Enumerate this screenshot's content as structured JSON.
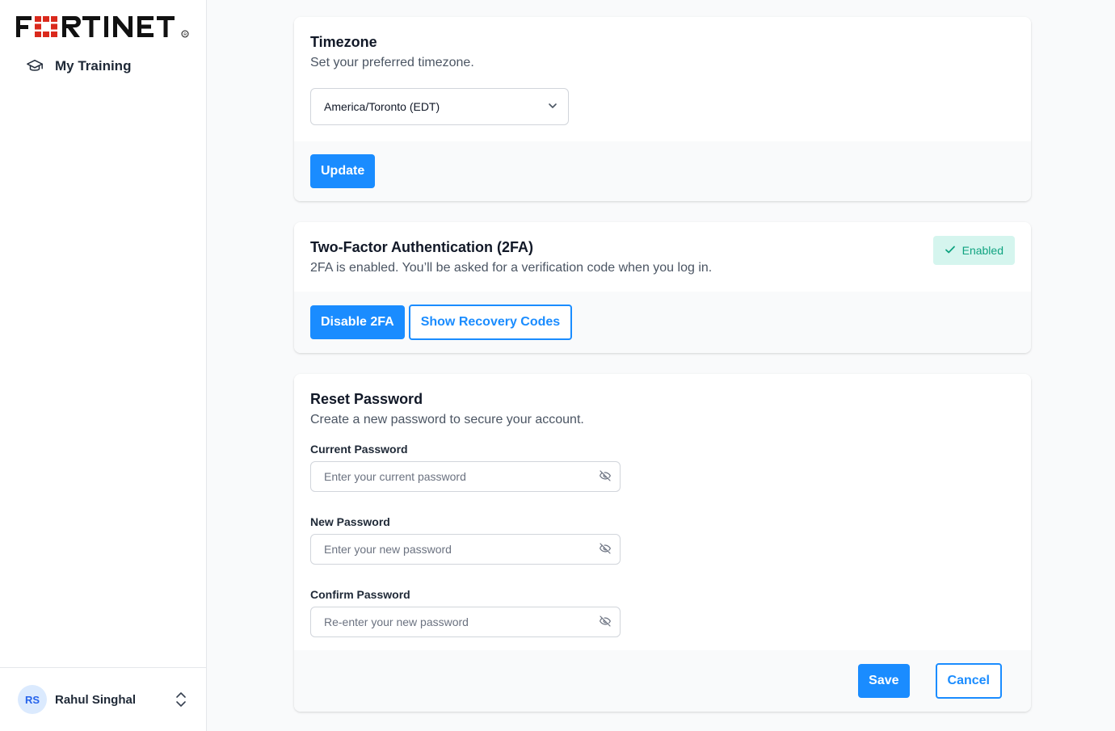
{
  "sidebar": {
    "logo_text": "FORTINET",
    "nav": [
      {
        "label": "My Training",
        "icon": "graduation-cap-icon"
      }
    ],
    "user": {
      "initials": "RS",
      "name": "Rahul Singhal"
    }
  },
  "timezone": {
    "title": "Timezone",
    "description": "Set your preferred timezone.",
    "selected": "America/Toronto (EDT)",
    "update_label": "Update"
  },
  "twofa": {
    "title": "Two-Factor Authentication (2FA)",
    "description": "2FA is enabled. You’ll be asked for a verification code when you log in.",
    "status": "Enabled",
    "disable_label": "Disable 2FA",
    "recovery_label": "Show Recovery Codes"
  },
  "reset_password": {
    "title": "Reset Password",
    "description": "Create a new password to secure your account.",
    "fields": [
      {
        "label": "Current Password",
        "placeholder": "Enter your current password"
      },
      {
        "label": "New Password",
        "placeholder": "Enter your new password"
      },
      {
        "label": "Confirm Password",
        "placeholder": "Re-enter your new password"
      }
    ],
    "save_label": "Save",
    "cancel_label": "Cancel"
  },
  "colors": {
    "brand_red": "#da291c",
    "primary_blue": "#1a8cff",
    "success_green": "#0fa380"
  }
}
